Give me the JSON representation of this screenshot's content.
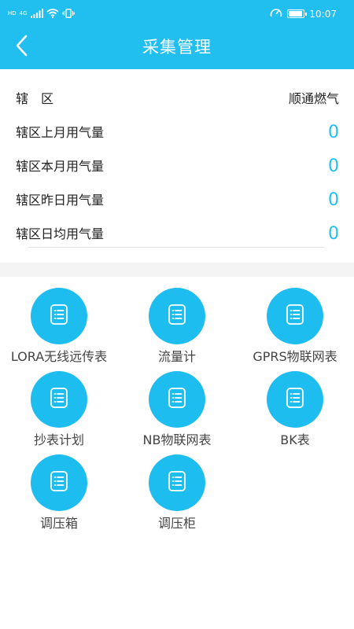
{
  "status_bar": {
    "left_badges": [
      "HD",
      "4G"
    ],
    "time": "10:07",
    "colors": {
      "bar": "#21BEF0",
      "text": "#FFFFFF"
    },
    "icons": [
      "signal-icon",
      "wifi-icon",
      "vibrate-icon",
      "speed-icon",
      "battery-icon"
    ]
  },
  "header": {
    "title": "采集管理",
    "back_icon": "chevron-left-icon",
    "colors": {
      "background": "#21BEF0",
      "text": "#FFFFFF"
    }
  },
  "info": {
    "district_label": "辖　区",
    "district_value": "顺通燃气",
    "rows": [
      {
        "label": "辖区上月用气量",
        "value": "0"
      },
      {
        "label": "辖区本月用气量",
        "value": "0"
      },
      {
        "label": "辖区昨日用气量",
        "value": "0"
      },
      {
        "label": "辖区日均用气量",
        "value": "0"
      }
    ],
    "value_color": "#21BEF0"
  },
  "menu": {
    "icon": "list-document-icon",
    "circle_color": "#1EBDF0",
    "items": [
      {
        "label": "LORA无线远传表"
      },
      {
        "label": "流量计"
      },
      {
        "label": "GPRS物联网表"
      },
      {
        "label": "抄表计划"
      },
      {
        "label": "NB物联网表"
      },
      {
        "label": "BK表"
      },
      {
        "label": "调压箱"
      },
      {
        "label": "调压柜"
      }
    ]
  }
}
